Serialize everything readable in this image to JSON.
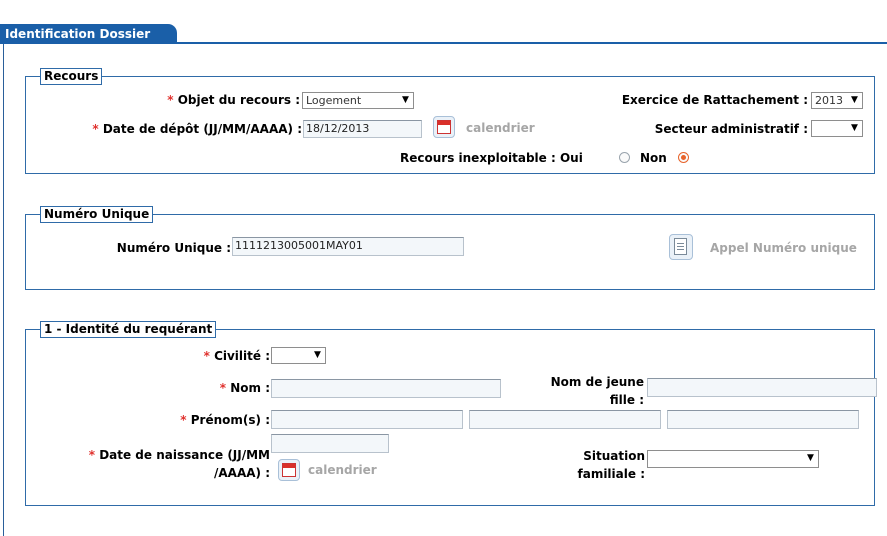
{
  "tab": {
    "label": "Identification Dossier"
  },
  "recours": {
    "legend": "Recours",
    "objet_label": "Objet du recours :",
    "objet_value": "Logement",
    "date_depot_label": "Date de dépôt (JJ/MM/AAAA) :",
    "date_depot_value": "18/12/2013",
    "calendrier": "calendrier",
    "exercice_label": "Exercice de Rattachement :",
    "exercice_value": "2013",
    "secteur_label": "Secteur administratif :",
    "secteur_value": "",
    "inexploitable_label": "Recours inexploitable :",
    "oui": "Oui",
    "non": "Non",
    "selected": "Non"
  },
  "numero": {
    "legend": "Numéro Unique",
    "label": "Numéro Unique :",
    "value": "1111213005001MAY01",
    "appel": "Appel Numéro unique"
  },
  "identite": {
    "legend": "1 - Identité du requérant",
    "civilite_label": "Civilité :",
    "civilite_value": "",
    "nom_label": "Nom :",
    "nom_value": "",
    "nom_jeune_fille_label_1": "Nom de jeune",
    "nom_jeune_fille_label_2": "fille :",
    "nom_jeune_fille_value": "",
    "prenom_label": "Prénom(s) :",
    "prenom_values": [
      "",
      "",
      ""
    ],
    "naissance_label_1": "Date de naissance (JJ/MM",
    "naissance_label_2": "/AAAA) :",
    "naissance_value": "",
    "calendrier": "calendrier",
    "situation_label_1": "Situation",
    "situation_label_2": "familiale :",
    "situation_value": ""
  },
  "required_marker": "*",
  "colors": {
    "accent": "#1a5fa8",
    "required": "#e0322e",
    "radio_selected": "#e7632b",
    "link_disabled": "#a6a6a6"
  }
}
